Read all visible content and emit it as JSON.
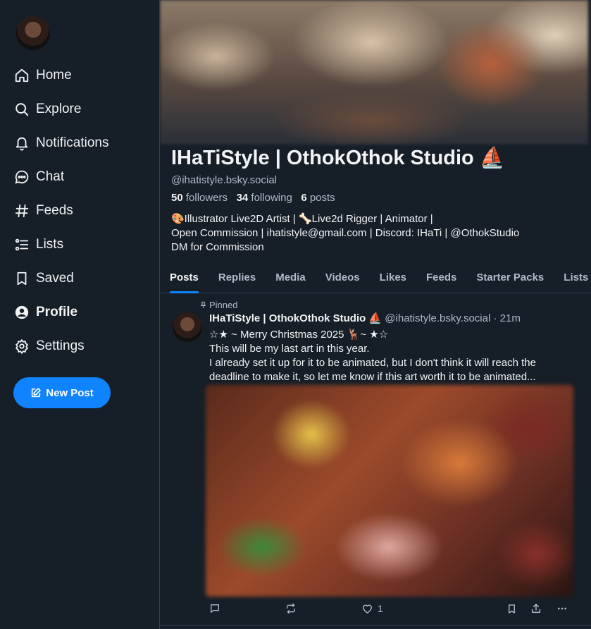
{
  "sidebar": {
    "items": [
      {
        "label": "Home",
        "icon": "home-icon"
      },
      {
        "label": "Explore",
        "icon": "search-icon"
      },
      {
        "label": "Notifications",
        "icon": "bell-icon"
      },
      {
        "label": "Chat",
        "icon": "chat-icon"
      },
      {
        "label": "Feeds",
        "icon": "hash-icon"
      },
      {
        "label": "Lists",
        "icon": "list-icon"
      },
      {
        "label": "Saved",
        "icon": "bookmark-icon"
      },
      {
        "label": "Profile",
        "icon": "profile-icon",
        "active": true
      },
      {
        "label": "Settings",
        "icon": "gear-icon"
      }
    ],
    "new_post_label": "New Post"
  },
  "profile": {
    "name": "IHaTiStyle | OthokOthok Studio ⛵",
    "handle": "@ihatistyle.bsky.social",
    "followers_count": "50",
    "followers_label": "followers",
    "following_count": "34",
    "following_label": "following",
    "posts_count": "6",
    "posts_label": "posts",
    "bio_lines": [
      "🎨Illustrator Live2D Artist | 🦴Live2d Rigger | Animator |",
      "Open Commission | ihatistyle@gmail.com | Discord: IHaTi | @OthokStudio",
      "DM for Commission"
    ]
  },
  "tabs": [
    "Posts",
    "Replies",
    "Media",
    "Videos",
    "Likes",
    "Feeds",
    "Starter Packs",
    "Lists"
  ],
  "active_tab": "Posts",
  "post": {
    "pinned_label": "Pinned",
    "author_name": "IHaTiStyle | OthokOthok Studio ⛵",
    "author_handle": "@ihatistyle.bsky.social",
    "time": "21m",
    "text_lines": [
      "☆★ ~ Merry Christmas 2025 🦌~ ★☆",
      "This will be my last art in this year.",
      "I already set it up for it to be animated, but I don't think it will reach the",
      "deadline to make it, so let me know if this art worth it to be animated..."
    ],
    "like_count": "1"
  },
  "colors": {
    "background": "#161e27",
    "accent": "#1083fe",
    "muted_text": "#aebbc9",
    "border": "#2e4052"
  }
}
